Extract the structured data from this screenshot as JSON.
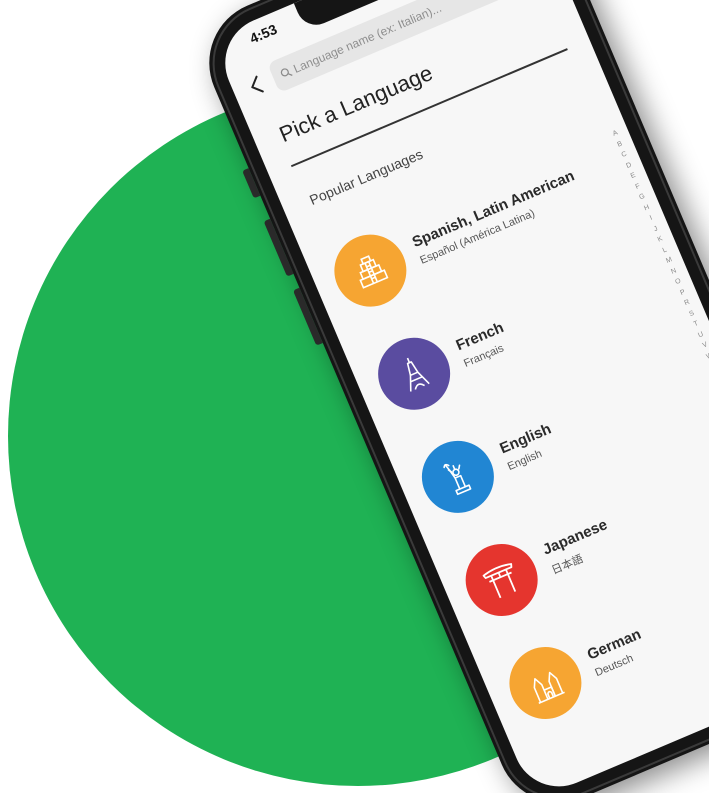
{
  "status_bar": {
    "time": "4:53"
  },
  "search": {
    "placeholder": "Language name (ex: Italian)..."
  },
  "page": {
    "title": "Pick a Language",
    "section_heading": "Popular Languages"
  },
  "languages": [
    {
      "name": "Spanish, Latin American",
      "native": "Español (América Latina)",
      "color": "#f6a532",
      "icon": "pyramid-icon"
    },
    {
      "name": "French",
      "native": "Français",
      "color": "#5a4ca0",
      "icon": "eiffel-tower-icon"
    },
    {
      "name": "English",
      "native": "English",
      "color": "#2186d3",
      "icon": "statue-of-liberty-icon"
    },
    {
      "name": "Japanese",
      "native": "日本語",
      "color": "#e5352e",
      "icon": "torii-gate-icon"
    },
    {
      "name": "German",
      "native": "Deutsch",
      "color": "#f6a532",
      "icon": "castle-icon"
    }
  ],
  "alpha_index": [
    "A",
    "B",
    "C",
    "D",
    "E",
    "F",
    "G",
    "H",
    "I",
    "J",
    "K",
    "L",
    "M",
    "N",
    "O",
    "P",
    "R",
    "S",
    "T",
    "U",
    "V",
    "W",
    "Y"
  ],
  "colors": {
    "background_circle": "#1fb254",
    "screen": "#f7f7f7",
    "phone_frame": "#151515"
  }
}
